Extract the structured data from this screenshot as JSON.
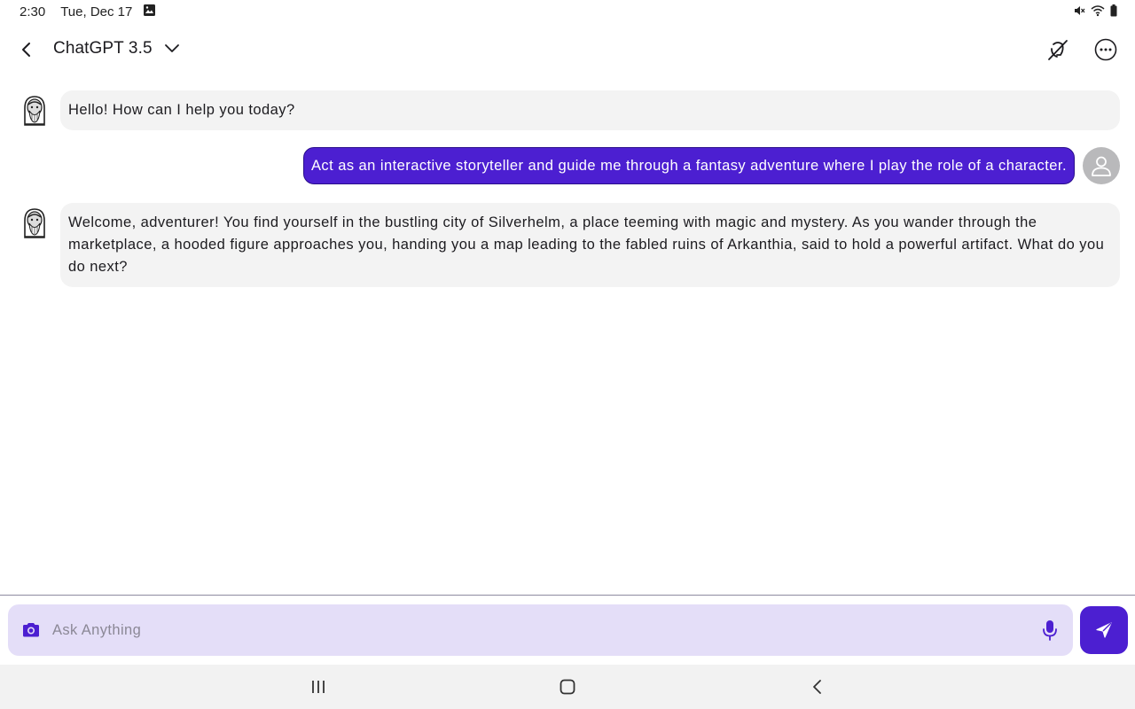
{
  "status_bar": {
    "time": "2:30",
    "date": "Tue, Dec 17",
    "icons": [
      "gallery-notification-icon",
      "mute-icon",
      "wifi-icon",
      "battery-icon"
    ]
  },
  "app_bar": {
    "title": "ChatGPT 3.5",
    "icons": [
      "back-arrow-icon",
      "chevron-down-icon",
      "voice-off-icon",
      "more-options-icon"
    ]
  },
  "messages": [
    {
      "role": "assistant",
      "text": "Hello! How can I help you today?"
    },
    {
      "role": "user",
      "text": "Act as an interactive storyteller and guide me through a fantasy adventure where I play the role of a character."
    },
    {
      "role": "assistant",
      "text": "Welcome, adventurer! You find yourself in the bustling city of Silverhelm, a place teeming with magic and mystery. As you wander through the marketplace, a hooded figure approaches you, handing you a map leading to the fabled ruins of Arkanthia, said to hold a powerful artifact. What do you do next?"
    }
  ],
  "composer": {
    "placeholder": "Ask Anything",
    "value": "",
    "icons": [
      "camera-icon",
      "microphone-icon",
      "send-icon"
    ]
  },
  "nav_bar": {
    "icons": [
      "recent-apps-icon",
      "home-icon",
      "system-back-icon"
    ]
  },
  "colors": {
    "accent": "#4c1fd1",
    "composer_bg": "#e4def8",
    "bot_bubble_bg": "#f3f3f3",
    "user_avatar_bg": "#b9b9bb"
  }
}
